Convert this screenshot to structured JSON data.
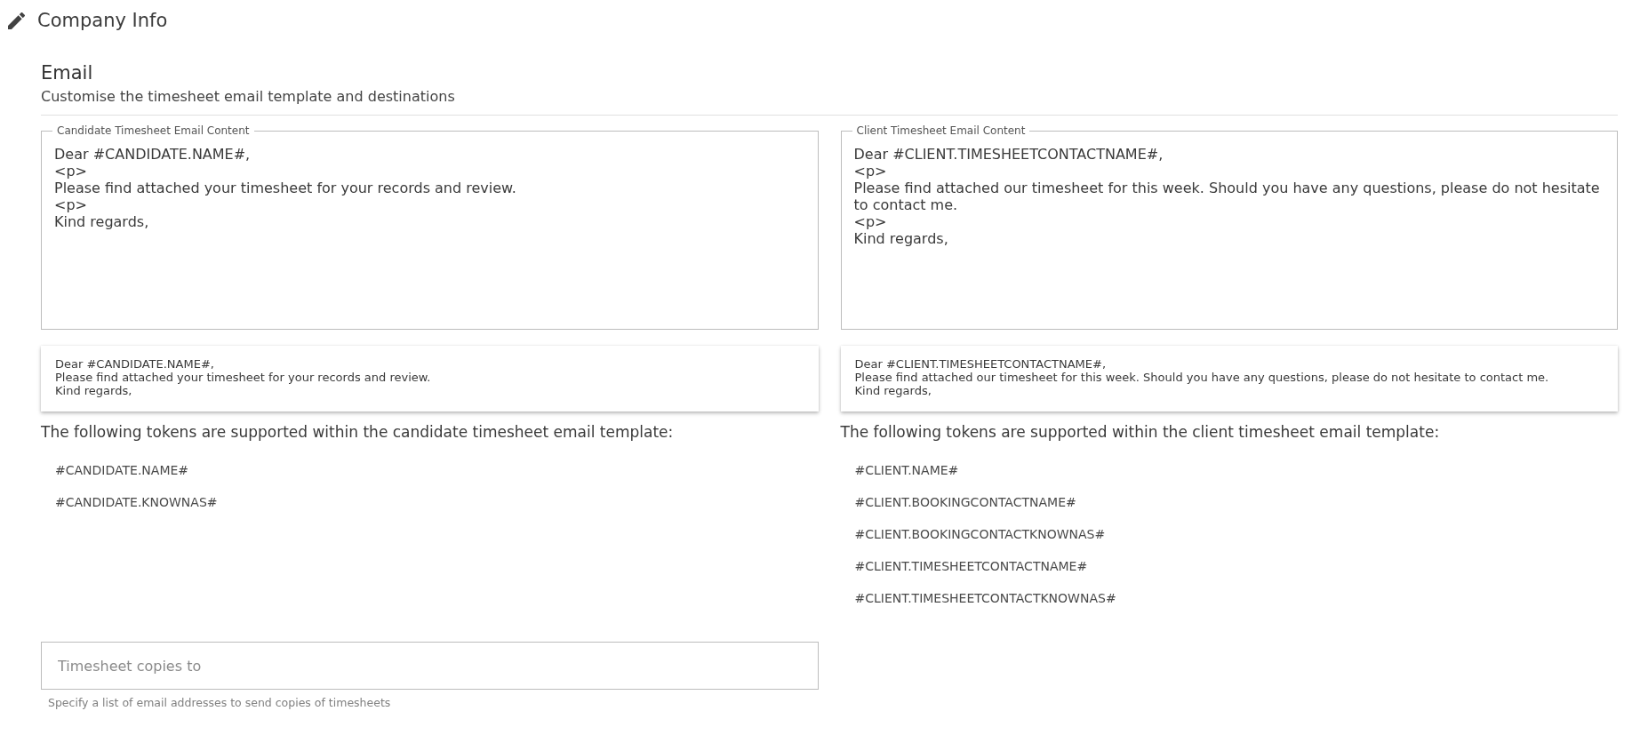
{
  "header": {
    "title": "Company Info"
  },
  "section": {
    "title": "Email",
    "subtitle": "Customise the timesheet email template and destinations"
  },
  "templates": [
    {
      "label": "Candidate Timesheet Email Content",
      "content": "Dear #CANDIDATE.NAME#,\n<p>\nPlease find attached your timesheet for your records and review.\n<p>\nKind regards,",
      "preview": "Dear #CANDIDATE.NAME#,\nPlease find attached your timesheet for your records and review.\nKind regards,",
      "tokens_intro": "The following tokens are supported within the candidate timesheet email template:",
      "tokens": [
        "#CANDIDATE.NAME#",
        "#CANDIDATE.KNOWNAS#"
      ]
    },
    {
      "label": "Client Timesheet Email Content",
      "content": "Dear #CLIENT.TIMESHEETCONTACTNAME#,\n<p>\nPlease find attached our timesheet for this week. Should you have any questions, please do not hesitate to contact me.\n<p>\nKind regards,",
      "preview": "Dear #CLIENT.TIMESHEETCONTACTNAME#,\nPlease find attached our timesheet for this week. Should you have any questions, please do not hesitate to contact me.\nKind regards,",
      "tokens_intro": "The following tokens are supported within the client timesheet email template:",
      "tokens": [
        "#CLIENT.NAME#",
        "#CLIENT.BOOKINGCONTACTNAME#",
        "#CLIENT.BOOKINGCONTACTKNOWNAS#",
        "#CLIENT.TIMESHEETCONTACTNAME#",
        "#CLIENT.TIMESHEETCONTACTKNOWNAS#"
      ]
    }
  ],
  "copies_field": {
    "placeholder": "Timesheet copies to",
    "hint": "Specify a list of email addresses to send copies of timesheets"
  }
}
